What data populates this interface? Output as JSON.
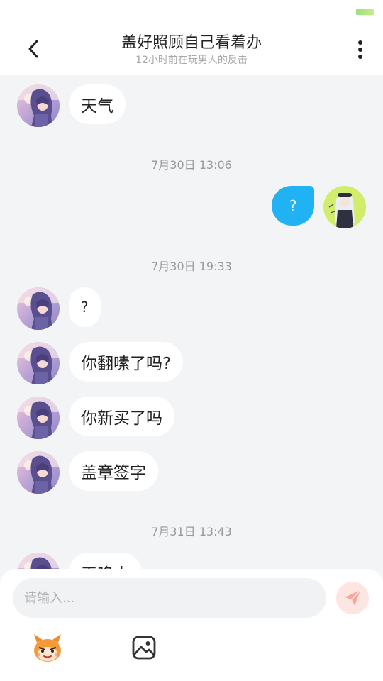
{
  "header": {
    "title": "盖好照顾自己看着办",
    "subtitle": "12小时前在玩男人的反击"
  },
  "messages": [
    {
      "side": "left",
      "text": "天气"
    },
    {
      "timestamp": "7月30日 13:06"
    },
    {
      "side": "right",
      "text": "?"
    },
    {
      "timestamp": "7月30日 19:33"
    },
    {
      "side": "left",
      "text": "?"
    },
    {
      "side": "left",
      "text": "你翻嗉了吗?"
    },
    {
      "side": "left",
      "text": "你新买了吗"
    },
    {
      "side": "left",
      "text": "盖章签字"
    },
    {
      "timestamp": "7月31日 13:43"
    },
    {
      "side": "left",
      "text": "干咚人"
    }
  ],
  "composer": {
    "placeholder": "请输入..."
  },
  "icons": {
    "back": "chevron-left-icon",
    "more": "more-vertical-icon",
    "send": "send-icon",
    "sticker": "sticker-mascot-icon",
    "image": "image-icon"
  },
  "colors": {
    "my_bubble": "#21b2f3",
    "send_button_bg": "#fde5e1",
    "send_icon": "#f6a79c",
    "background": "#f3f4f6"
  }
}
